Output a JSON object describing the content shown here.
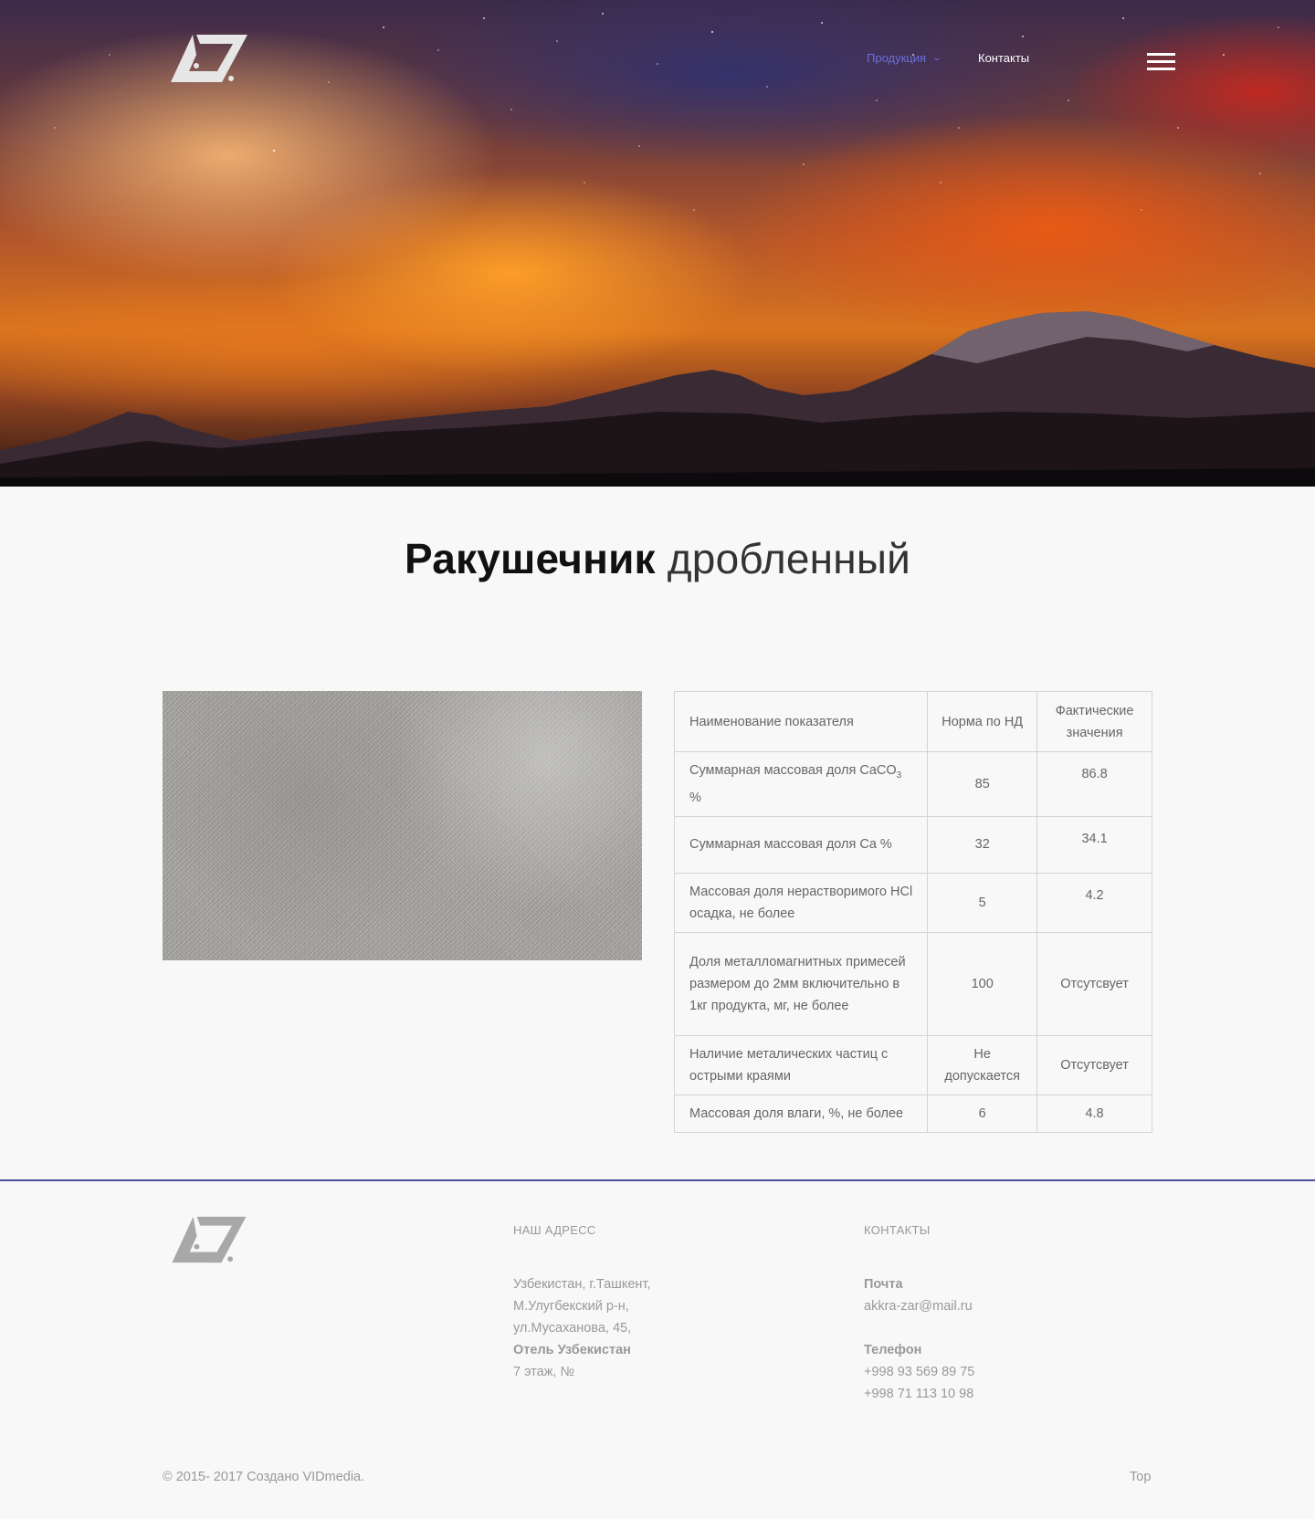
{
  "header": {
    "logo_icon": "a7-triangle-logo",
    "nav": {
      "products_label": "Продукция",
      "products_chevron_icon": "chevron-down-icon",
      "contacts_label": "Контакты"
    },
    "menu_icon": "hamburger-menu-icon"
  },
  "page": {
    "title_bold": "Ракушечник",
    "title_light": "дробленный"
  },
  "table": {
    "headers": [
      "Наименование показателя",
      "Норма по НД",
      "Фактические значения"
    ],
    "rows": [
      {
        "name": "Суммарная массовая доля CaCO",
        "name_sub": "3",
        "name_tail": " %",
        "norm": "85",
        "actual": "86.8"
      },
      {
        "name": "Суммарная массовая доля Ca %",
        "norm": "32",
        "actual": "34.1"
      },
      {
        "name": "Массовая доля нерастворимого HCl осадка, не более",
        "norm": "5",
        "actual": "4.2"
      },
      {
        "name": "Доля металломагнитных примесей размером до 2мм включительно в 1кг продукта, мг, не более",
        "norm": "100",
        "actual": "Отсутсвует"
      },
      {
        "name": "Наличие металических частиц с острыми краями",
        "norm": "Не допускается",
        "actual": "Отсутсвует"
      },
      {
        "name": "Массовая доля влаги, %, не более",
        "norm": "6",
        "actual": "4.8"
      }
    ]
  },
  "footer": {
    "address_heading": "НАШ АДРЕСС",
    "address_line1": "Узбекистан, г.Ташкент,",
    "address_line2": "М.Улугбекский р-н,",
    "address_line3": "ул.Мусаханова, 45,",
    "address_hotel": "Отель Узбекистан",
    "address_floor": "7 этаж, №",
    "contacts_heading": "КОНТАКТЫ",
    "mail_label": "Почта",
    "mail_value": "akkra-zar@mail.ru",
    "phone_label": "Телефон",
    "phone1": "+998 93 569 89 75",
    "phone2": "+998 71 113 10 98",
    "copyright": "© 2015- 2017 Создано VIDmedia.",
    "top_label": "Top"
  },
  "colors": {
    "nav_active": "#6a6fd8",
    "footer_line": "#4a4f9c"
  }
}
